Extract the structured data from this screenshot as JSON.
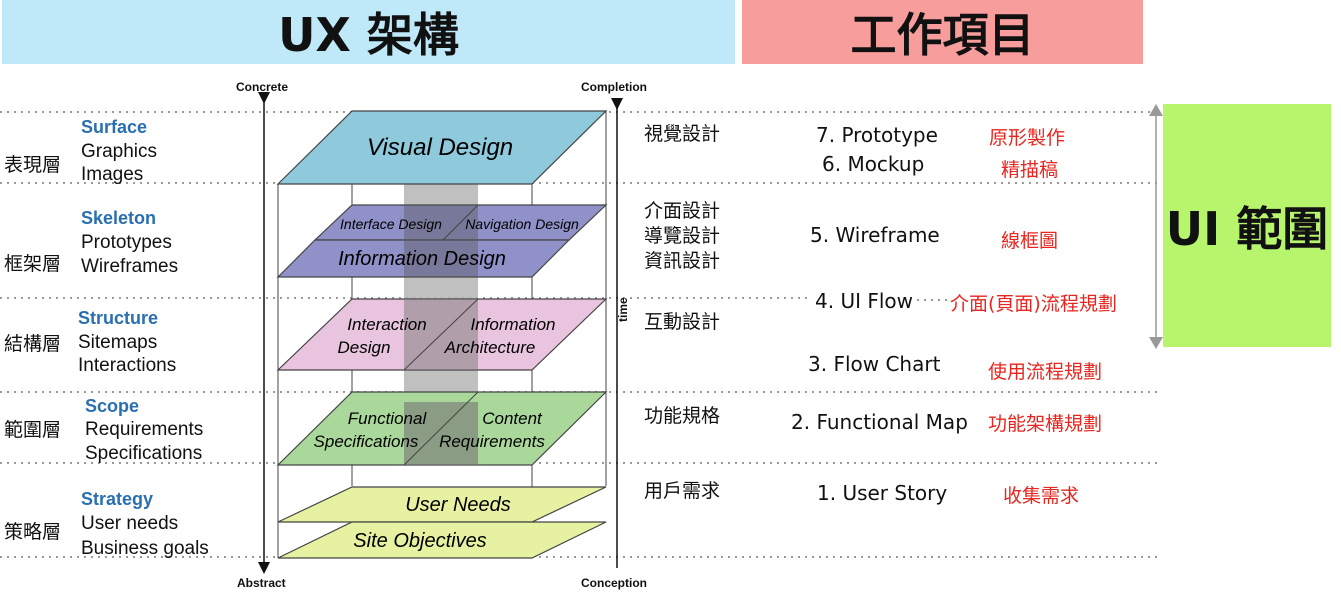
{
  "banners": {
    "ux_arch": "UX 架構",
    "work_items": "工作項目",
    "ui_scope": "UI 範圍"
  },
  "axis": {
    "concrete": "Concrete",
    "abstract": "Abstract",
    "completion": "Completion",
    "conception": "Conception",
    "time": "time"
  },
  "layers": [
    {
      "zh": "表現層",
      "en": "Surface",
      "items": [
        "Graphics",
        "Images"
      ]
    },
    {
      "zh": "框架層",
      "en": "Skeleton",
      "items": [
        "Prototypes",
        "Wireframes"
      ]
    },
    {
      "zh": "結構層",
      "en": "Structure",
      "items": [
        "Sitemaps",
        "Interactions"
      ]
    },
    {
      "zh": "範圍層",
      "en": "Scope",
      "items": [
        "Requirements",
        "Specifications"
      ]
    },
    {
      "zh": "策略層",
      "en": "Strategy",
      "items": [
        "User needs",
        "Business goals"
      ]
    }
  ],
  "planes": {
    "visual": "Visual Design",
    "interface": "Interface Design",
    "navigation": "Navigation Design",
    "information_design": "Information Design",
    "interaction_1": "Interaction",
    "interaction_2": "Design",
    "info_arch_1": "Information",
    "info_arch_2": "Architecture",
    "functional_1": "Functional",
    "functional_2": "Specifications",
    "content_1": "Content",
    "content_2": "Requirements",
    "user_needs": "User Needs",
    "site_objectives": "Site Objectives"
  },
  "tasks": {
    "surface": "視覺設計",
    "skeleton_1": "介面設計",
    "skeleton_2": "導覽設計",
    "skeleton_3": "資訊設計",
    "structure": "互動設計",
    "scope": "功能規格",
    "strategy": "用戶需求"
  },
  "work_items": [
    {
      "en": "7. Prototype",
      "zh": "原形製作"
    },
    {
      "en": "6. Mockup",
      "zh": "精描稿"
    },
    {
      "en": "5. Wireframe",
      "zh": "線框圖"
    },
    {
      "en": "4. UI Flow",
      "zh": "介面(頁面)流程規劃"
    },
    {
      "en": "3. Flow Chart",
      "zh": "使用流程規劃"
    },
    {
      "en": "2. Functional Map",
      "zh": "功能架構規劃"
    },
    {
      "en": "1. User Story",
      "zh": "收集需求"
    }
  ],
  "colors": {
    "surface": "#8ec9dc",
    "skeleton": "#8f91c8",
    "structure": "#e9c4de",
    "scope": "#a9d89a",
    "strategy": "#e6f2a2",
    "red": "#e8261f"
  }
}
